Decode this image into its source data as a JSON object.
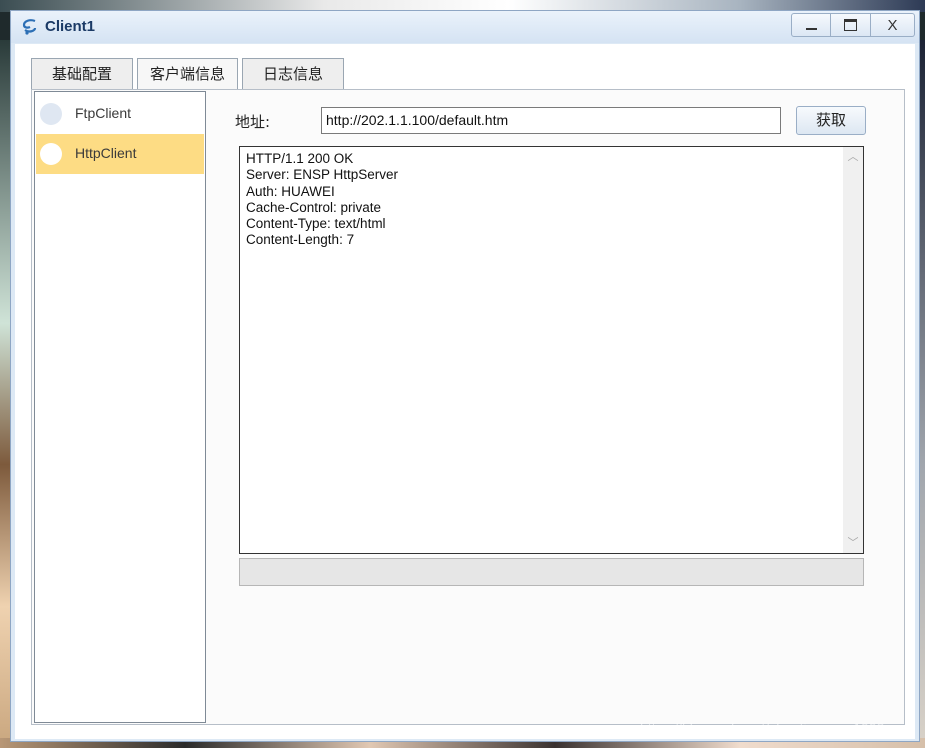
{
  "window": {
    "title": "Client1",
    "controls": {
      "minimize": "—",
      "maximize": "□",
      "close": "X"
    }
  },
  "tabs": [
    {
      "label": "基础配置"
    },
    {
      "label": "客户端信息"
    },
    {
      "label": "日志信息"
    }
  ],
  "active_tab": "客户端信息",
  "sidebar": {
    "items": [
      {
        "label": "FtpClient"
      },
      {
        "label": "HttpClient"
      }
    ],
    "selected": "HttpClient"
  },
  "http": {
    "address_label": "地址:",
    "address_value": "http://202.1.1.100/default.htm",
    "get_button": "获取",
    "response_lines": [
      "HTTP/1.1 200 OK",
      "Server: ENSP HttpServer",
      "Auth: HUAWEI",
      "Cache-Control: private",
      "Content-Type: text/html",
      "Content-Length: 7"
    ],
    "progress": 0
  },
  "watermark": "https://blog.csdn.net/zhaotiannuo_1998",
  "colors": {
    "selected_item": "#fddc84",
    "title_text": "#1b3a66"
  }
}
